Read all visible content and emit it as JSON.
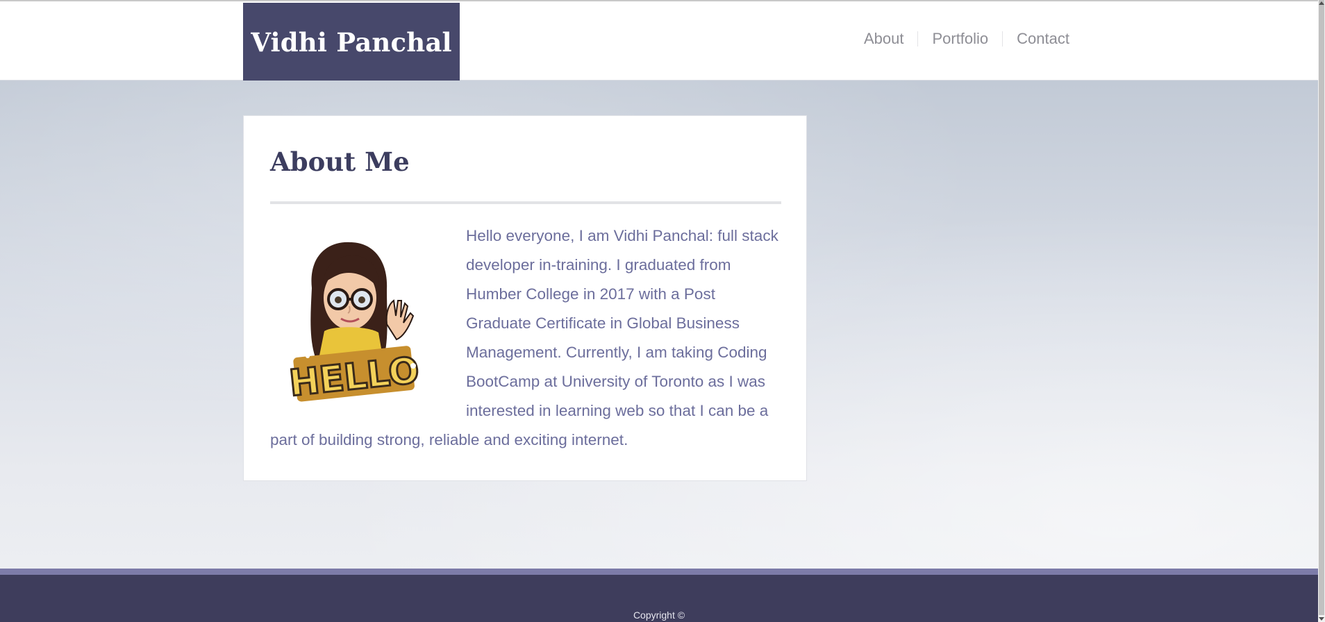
{
  "header": {
    "logo": "Vidhi Panchal",
    "nav": [
      {
        "label": "About"
      },
      {
        "label": "Portfolio"
      },
      {
        "label": "Contact"
      }
    ]
  },
  "about": {
    "title": "About Me",
    "avatar_icon": "bitmoji-hello-avatar",
    "avatar_text": "HELLO",
    "body": "Hello everyone, I am Vidhi Panchal: full stack developer in-training. I graduated from Humber College in 2017 with a Post Graduate Certificate in Global Business Management. Currently, I am taking Coding BootCamp at University of Toronto as I was interested in learning web so that I can be a part of building strong, reliable and exciting internet."
  },
  "footer": {
    "copyright": "Copyright ©"
  },
  "colors": {
    "brand": "#47486b",
    "text_accent": "#6c6e9c",
    "footer": "#3e3d5c",
    "footer_stripe": "#7d7ca9"
  }
}
